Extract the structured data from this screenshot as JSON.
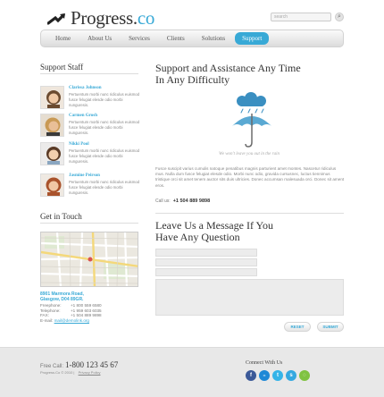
{
  "header": {
    "logo_main": "Progress.",
    "logo_accent": "co",
    "search_placeholder": "search",
    "search_button": "⌕"
  },
  "nav": [
    {
      "label": "Home",
      "active": false
    },
    {
      "label": "About Us",
      "active": false
    },
    {
      "label": "Services",
      "active": false
    },
    {
      "label": "Clients",
      "active": false
    },
    {
      "label": "Solutions",
      "active": false
    },
    {
      "label": "Support",
      "active": true
    }
  ],
  "staff": {
    "title": "Support Staff",
    "people": [
      {
        "name": "Clarissa Johnson",
        "bio": "Pertuentum morbi nunc ridiculus euismod fusce felugiat elesde odio morbi nunguresis.",
        "hair": "#6b4a2f"
      },
      {
        "name": "Carmen Grosh",
        "bio": "Pertuentum morbi nunc ridiculus euismod fusce felugiat elesde odio morbi nunguresis.",
        "hair": "#c99a55"
      },
      {
        "name": "Nikki Pool",
        "bio": "Pertuentum morbi nunc ridiculus euismod fusce felugiat elesde odio morbi nunguresis.",
        "hair": "#5a3b26"
      },
      {
        "name": "Jasmine Peirson",
        "bio": "Pertuentum morbi nunc ridiculus euismod fusce felugiat elesde odio morbi nunguresis.",
        "hair": "#a9532c"
      }
    ]
  },
  "touch": {
    "title": "Get in Touch",
    "address_line1": "8901 Marmora Road,",
    "address_line2": "Glasgow, D04 89GR.",
    "freephone_label": "Freephone:",
    "freephone": "+1 800 559 6580",
    "telephone_label": "Telephone:",
    "telephone": "+1 959 603 6035",
    "fax_label": "FAX:",
    "fax": "+1 504 889 9898",
    "email_label": "E-mail:",
    "email": "mail@demolink.org"
  },
  "support": {
    "title_line1": "Support and Assistance Any Time",
    "title_line2": "In Any Difficulty",
    "caption": "We won't leave you out in the rain",
    "paragraph": "Fusce suscipit varius cumulis natoque penatibus magnis parturient amet montes. Nascetur ridiculus mus. Nulla dum fusce felugiat elesde odio. Morbi nunc odio, gravida cursusnec, luctus tiennimus tristique orci sit amet tenem auctor sits duis ultricies. Donec accumsan malesuada orci. Donec sit ament eros.",
    "callus_label": "Call us:",
    "callus_number": "+1 504 889 9898"
  },
  "message": {
    "title_line1": "Leave Us a Message If You",
    "title_line2": "Have Any Question",
    "reset_label": "RESET",
    "submit_label": "SUBMIT"
  },
  "footer": {
    "freecall_label": "Free Call:",
    "freecall_number": "1-800 123 45 67",
    "copyright": "Progress.Co © 2010",
    "privacy": "Privacy Policy",
    "connect_title": "Connect With Us",
    "social": [
      {
        "name": "facebook-icon",
        "glyph": "f",
        "color": "#3b5998"
      },
      {
        "name": "flickr-icon",
        "glyph": "••",
        "color": "#1e88d6"
      },
      {
        "name": "twitter-icon",
        "glyph": "t",
        "color": "#35b4e8"
      },
      {
        "name": "skype-icon",
        "glyph": "s",
        "color": "#34a8e0"
      },
      {
        "name": "rss-icon",
        "glyph": "◌",
        "color": "#7fc241"
      }
    ]
  },
  "colors": {
    "accent": "#38a9d6",
    "footer_bg": "#e8e8e8"
  }
}
